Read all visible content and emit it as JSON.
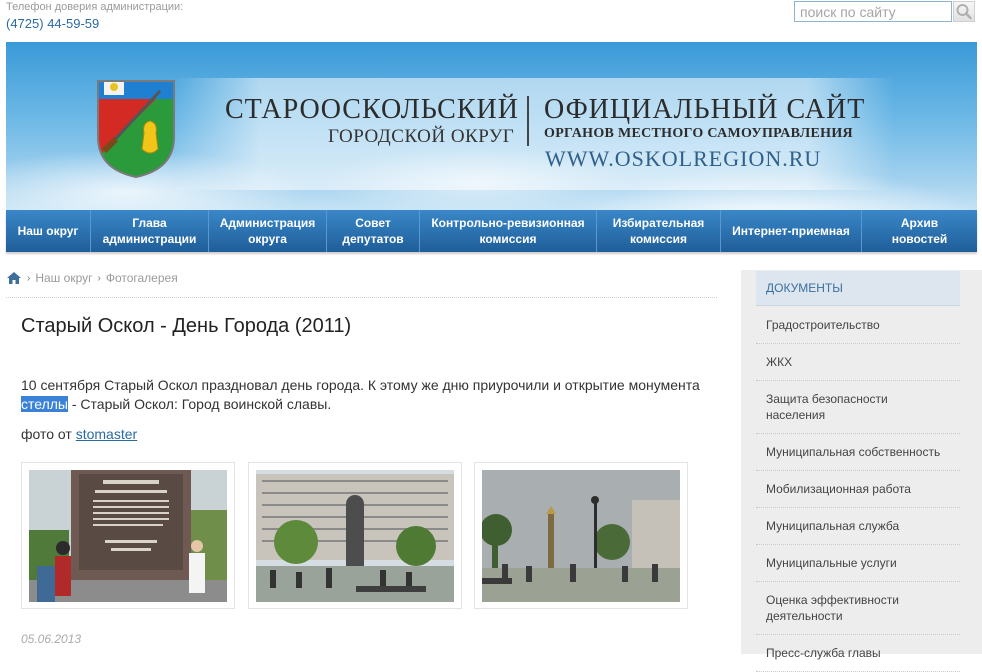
{
  "header": {
    "hotline_label": "Телефон доверия администрации:",
    "hotline_phone": "(4725) 44-59-59",
    "search_placeholder": "поиск по сайту"
  },
  "banner": {
    "district_name": "СТАРООСКОЛЬСКИЙ",
    "district_sub": "ГОРОДСКОЙ ОКРУГ",
    "site_title": "ОФИЦИАЛЬНЫЙ САЙТ",
    "site_sub": "ОРГАНОВ МЕСТНОГО САМОУПРАВЛЕНИЯ",
    "site_url": "WWW.OSKOLREGION.RU"
  },
  "nav": {
    "items": [
      {
        "line1": "Наш округ",
        "line2": ""
      },
      {
        "line1": "Глава",
        "line2": "администрации"
      },
      {
        "line1": "Администрация",
        "line2": "округа"
      },
      {
        "line1": "Совет",
        "line2": "депутатов"
      },
      {
        "line1": "Контрольно-ревизионная",
        "line2": "комиссия"
      },
      {
        "line1": "Избирательная",
        "line2": "комиссия"
      },
      {
        "line1": "Интернет-приемная",
        "line2": ""
      },
      {
        "line1": "Архив",
        "line2": "новостей"
      }
    ]
  },
  "breadcrumb": {
    "items": [
      "Наш округ",
      "Фотогалерея"
    ]
  },
  "article": {
    "title": "Старый Оскол - День Города (2011)",
    "intro_before": "10 сентября Старый Оскол праздновал день города. К этому же дню приурочили и открытие монумента ",
    "intro_highlight": "стеллы",
    "intro_after": " - Старый Оскол: Город воинской славы.",
    "credit_prefix": "фото от ",
    "credit_author": "stomaster",
    "date": "05.06.2013"
  },
  "sidebar": {
    "heading": "ДОКУМЕНТЫ",
    "items": [
      "Градостроительство",
      "ЖКХ",
      "Защита безопасности населения",
      "Муниципальная собственность",
      "Мобилизационная работа",
      "Муниципальная служба",
      "Муниципальные услуги",
      "Оценка эффективности деятельности",
      "Пресс-служба главы"
    ]
  }
}
